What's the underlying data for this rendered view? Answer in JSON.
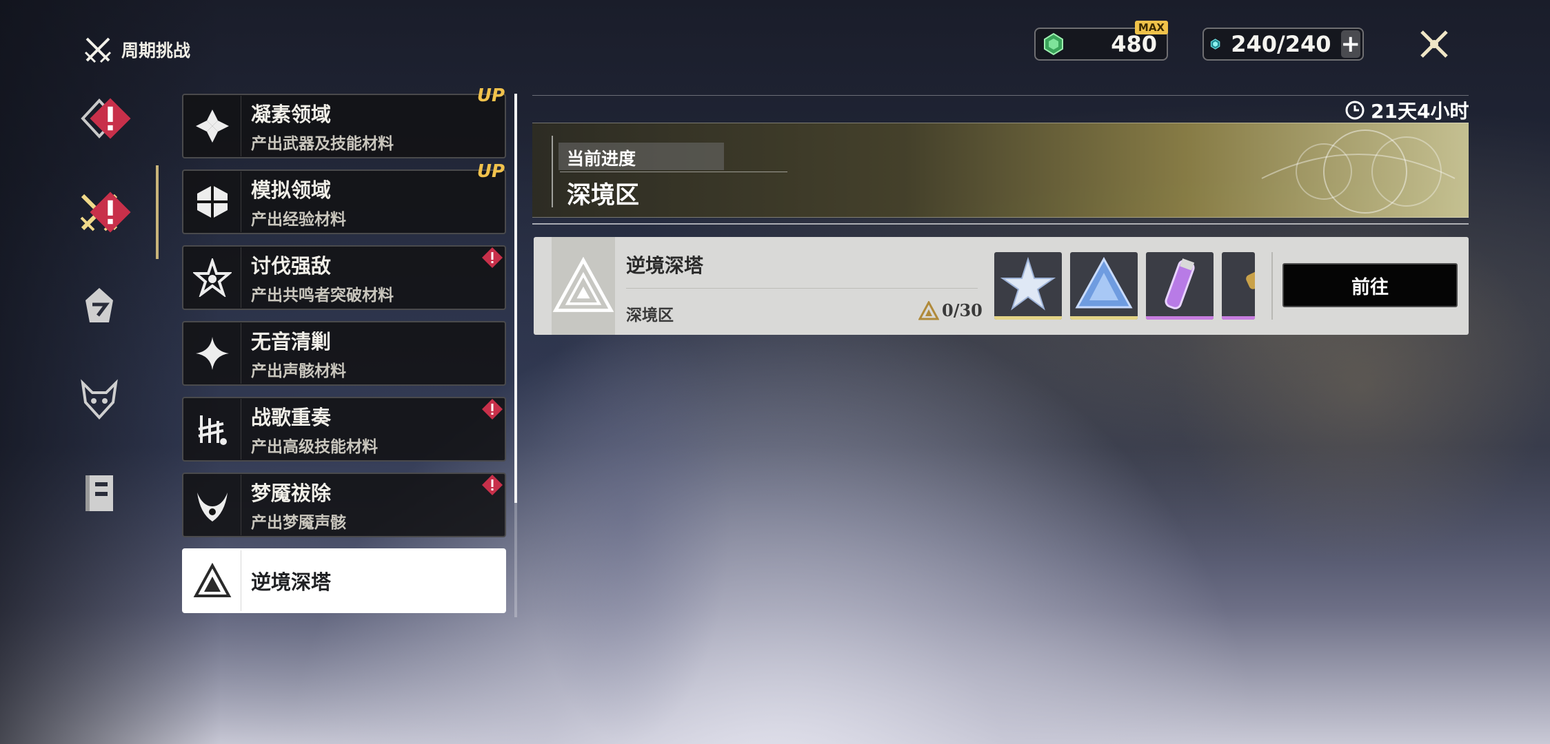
{
  "header": {
    "title": "周期挑战",
    "stamina": {
      "value": "480",
      "badge": "MAX"
    },
    "crystal": {
      "value": "240/240",
      "plus": "+"
    }
  },
  "left_nav": {
    "items": [
      {
        "name": "nav-item-1",
        "badge": true
      },
      {
        "name": "nav-item-periodic-challenge",
        "badge": true,
        "active": true
      },
      {
        "name": "nav-item-3",
        "badge": false
      },
      {
        "name": "nav-item-4",
        "badge": false
      },
      {
        "name": "nav-item-5",
        "badge": false
      }
    ]
  },
  "challenge_list": [
    {
      "name": "凝素领域",
      "sub": "产出武器及技能材料",
      "tag": "UP"
    },
    {
      "name": "模拟领域",
      "sub": "产出经验材料",
      "tag": "UP"
    },
    {
      "name": "讨伐强敌",
      "sub": "产出共鸣者突破材料",
      "tag": ""
    },
    {
      "name": "无音清剿",
      "sub": "产出声骸材料",
      "tag": ""
    },
    {
      "name": "战歌重奏",
      "sub": "产出高级技能材料",
      "tag": ""
    },
    {
      "name": "梦魇祓除",
      "sub": "产出梦魇声骸",
      "tag": ""
    },
    {
      "name": "逆境深塔",
      "sub": "",
      "tag": "",
      "selected": true
    }
  ],
  "detail": {
    "timer": "21天4小时",
    "progress_label": "当前进度",
    "progress_value": "深境区",
    "tower": {
      "name": "逆境深塔",
      "zone": "深境区",
      "score": "0/30",
      "go_label": "前往",
      "rewards": [
        {
          "icon": "star-crystal-icon",
          "rarity_color": "#e3d487"
        },
        {
          "icon": "blue-prism-icon",
          "rarity_color": "#e3d487"
        },
        {
          "icon": "purple-vial-icon",
          "rarity_color": "#c77de0"
        },
        {
          "icon": "gold-tube-icon",
          "rarity_color": "#c77de0"
        }
      ]
    }
  }
}
